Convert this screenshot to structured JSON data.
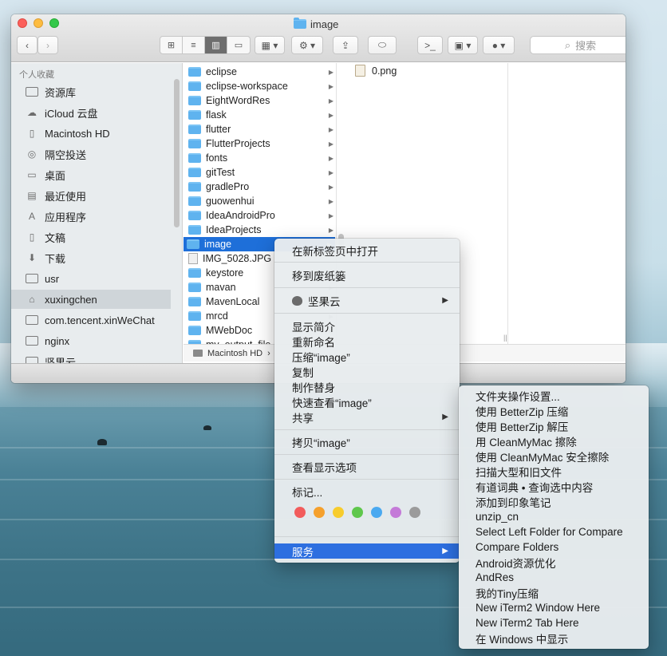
{
  "window": {
    "title": "image",
    "search_placeholder": "搜索",
    "path_bar": [
      "Macintosh HD",
      "›"
    ]
  },
  "sidebar": {
    "section": "个人收藏",
    "items": [
      {
        "label": "资源库",
        "icon": "folder-icon"
      },
      {
        "label": "iCloud 云盘",
        "icon": "cloud-icon"
      },
      {
        "label": "Macintosh HD",
        "icon": "document-icon"
      },
      {
        "label": "隔空投送",
        "icon": "airdrop-icon"
      },
      {
        "label": "桌面",
        "icon": "desktop-icon"
      },
      {
        "label": "最近使用",
        "icon": "recents-icon"
      },
      {
        "label": "应用程序",
        "icon": "applications-icon"
      },
      {
        "label": "文稿",
        "icon": "documents-icon"
      },
      {
        "label": "下载",
        "icon": "download-icon"
      },
      {
        "label": "usr",
        "icon": "folder-icon"
      },
      {
        "label": "xuxingchen",
        "icon": "home-icon",
        "selected": true
      },
      {
        "label": "com.tencent.xinWeChat",
        "icon": "folder-icon"
      },
      {
        "label": "nginx",
        "icon": "folder-icon"
      },
      {
        "label": "坚果云",
        "icon": "folder-icon"
      }
    ]
  },
  "column1": {
    "items": [
      {
        "label": "eclipse",
        "type": "folder"
      },
      {
        "label": "eclipse-workspace",
        "type": "folder"
      },
      {
        "label": "EightWordRes",
        "type": "folder"
      },
      {
        "label": "flask",
        "type": "folder"
      },
      {
        "label": "flutter",
        "type": "folder"
      },
      {
        "label": "FlutterProjects",
        "type": "folder"
      },
      {
        "label": "fonts",
        "type": "folder"
      },
      {
        "label": "gitTest",
        "type": "folder"
      },
      {
        "label": "gradlePro",
        "type": "folder"
      },
      {
        "label": "guowenhui",
        "type": "folder"
      },
      {
        "label": "IdeaAndroidPro",
        "type": "folder"
      },
      {
        "label": "IdeaProjects",
        "type": "folder"
      },
      {
        "label": "image",
        "type": "folder",
        "selected": true
      },
      {
        "label": "IMG_5028.JPG",
        "type": "file"
      },
      {
        "label": "keystore",
        "type": "folder"
      },
      {
        "label": "mavan",
        "type": "folder"
      },
      {
        "label": "MavenLocal",
        "type": "folder"
      },
      {
        "label": "mrcd",
        "type": "folder"
      },
      {
        "label": "MWebDoc",
        "type": "folder"
      },
      {
        "label": "my_output_file",
        "type": "folder"
      }
    ]
  },
  "column2": {
    "items": [
      {
        "label": "0.png",
        "type": "file"
      }
    ]
  },
  "context_menu": {
    "open_in_new_tab": "在新标签页中打开",
    "move_to_trash": "移到废纸篓",
    "jianguoyun": "坚果云",
    "get_info": "显示简介",
    "rename": "重新命名",
    "compress": "压缩“image”",
    "duplicate": "复制",
    "make_alias": "制作替身",
    "quick_look": "快速查看“image”",
    "share": "共享",
    "copy": "拷贝“image”",
    "view_options": "查看显示选项",
    "tags": "标记...",
    "services": "服务",
    "tag_colors": [
      "#f25c5c",
      "#f5a02c",
      "#f7cc2d",
      "#5fc74c",
      "#4aa9f0",
      "#c47ad8",
      "#9b9b9b"
    ]
  },
  "services_menu": {
    "items": [
      "文件夹操作设置...",
      "使用 BetterZip 压缩",
      "使用 BetterZip 解压",
      "用 CleanMyMac 擦除",
      "使用 CleanMyMac 安全擦除",
      "扫描大型和旧文件",
      "有道词典 • 查询选中内容",
      "添加到印象笔记",
      "unzip_cn",
      "Select Left Folder for Compare",
      "Compare Folders",
      "Android资源优化",
      "AndRes",
      "我的Tiny压缩",
      "New iTerm2 Window Here",
      "New iTerm2 Tab Here",
      "在 Windows 中显示"
    ]
  }
}
